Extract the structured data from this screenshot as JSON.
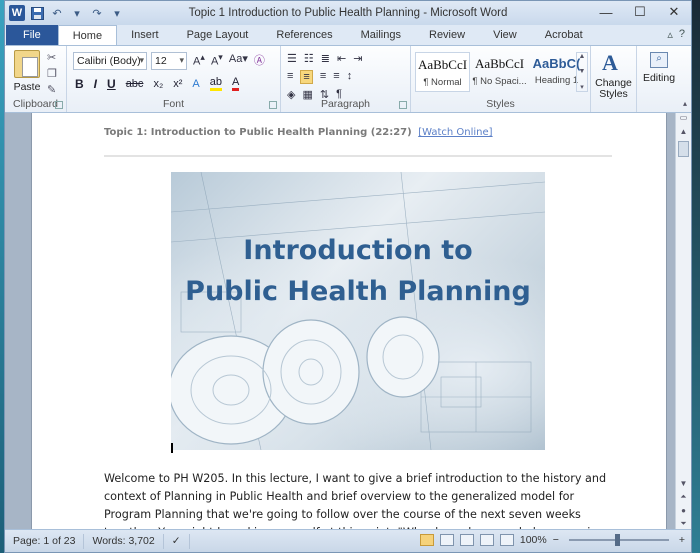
{
  "window": {
    "title": "Topic 1 Introduction to Public Health Planning - Microsoft Word",
    "minimize": "—",
    "maximize": "☐",
    "close": "✕",
    "app_logo": "W"
  },
  "quick_access": {
    "save_icon": "save-icon",
    "undo_icon": "undo-icon",
    "redo_icon": "redo-icon"
  },
  "tabs": [
    "File",
    "Home",
    "Insert",
    "Page Layout",
    "References",
    "Mailings",
    "Review",
    "View",
    "Acrobat"
  ],
  "active_tab": "Home",
  "ribbon": {
    "clipboard": {
      "paste_label": "Paste",
      "group_label": "Clipboard"
    },
    "font": {
      "font_name": "Calibri (Body)",
      "font_size": "12",
      "group_label": "Font"
    },
    "paragraph": {
      "group_label": "Paragraph"
    },
    "styles": {
      "group_label": "Styles",
      "items": [
        {
          "sample": "AaBbCcI",
          "name": "¶ Normal"
        },
        {
          "sample": "AaBbCcI",
          "name": "¶ No Spaci..."
        },
        {
          "sample": "AaBbC(",
          "name": "Heading 1"
        }
      ]
    },
    "change_styles_label": "Change Styles",
    "editing_label": "Editing"
  },
  "document": {
    "header_text": "Topic 1: Introduction to Public Health Planning (22:27)",
    "header_link": "[Watch Online]",
    "banner_line1": "Introduction to",
    "banner_line2": "Public Health Planning",
    "body_text": "Welcome to PH W205. In this lecture, I want to give a brief introduction to the history and context of Planning in Public Health and brief overview to the generalized model for Program Planning that we're going to follow over the course of the next seven weeks together. You might be asking yourself at this point, \"Why do we have a whole course in Program Planning? I've planned things"
  },
  "status": {
    "page": "Page: 1 of 23",
    "words": "Words: 3,702",
    "zoom": "100%"
  },
  "colors": {
    "accent": "#2b579a",
    "banner_text": "#2f5f91"
  }
}
